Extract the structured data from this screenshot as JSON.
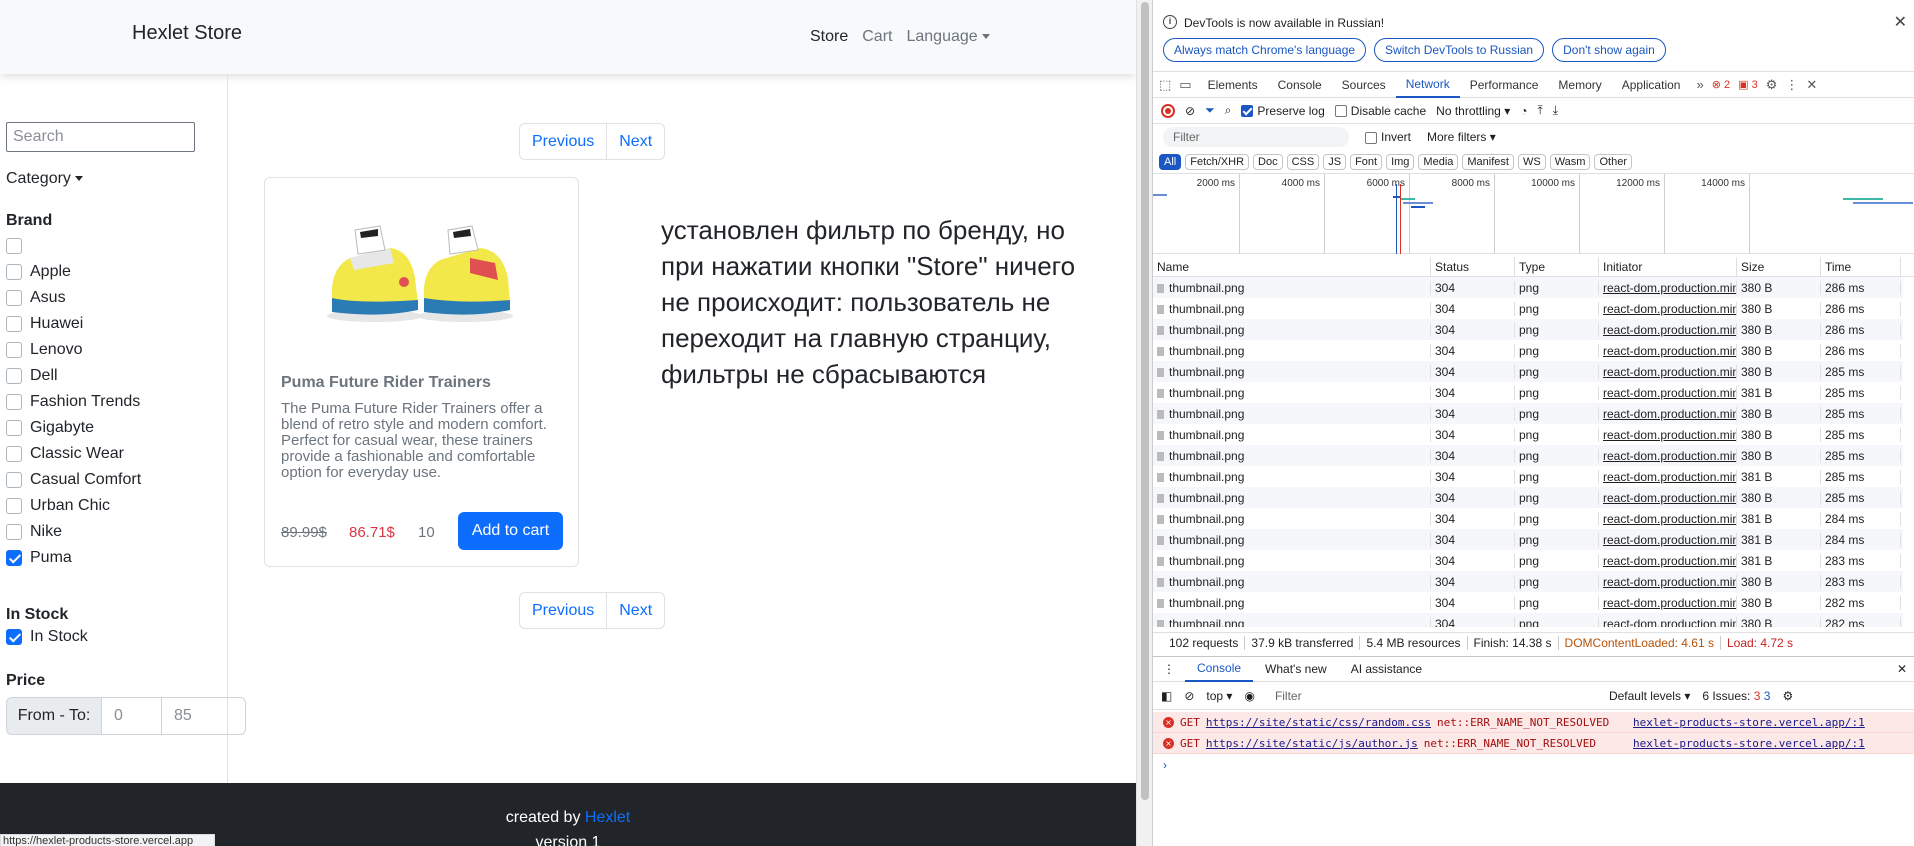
{
  "store": {
    "brand": "Hexlet Store",
    "nav": {
      "store": "Store",
      "cart": "Cart",
      "language": "Language"
    },
    "search_placeholder": "Search",
    "category": "Category",
    "brand_heading": "Brand",
    "brands": [
      {
        "label": "",
        "checked": false
      },
      {
        "label": "Apple",
        "checked": false
      },
      {
        "label": "Asus",
        "checked": false
      },
      {
        "label": "Huawei",
        "checked": false
      },
      {
        "label": "Lenovo",
        "checked": false
      },
      {
        "label": "Dell",
        "checked": false
      },
      {
        "label": "Fashion Trends",
        "checked": false
      },
      {
        "label": "Gigabyte",
        "checked": false
      },
      {
        "label": "Classic Wear",
        "checked": false
      },
      {
        "label": "Casual Comfort",
        "checked": false
      },
      {
        "label": "Urban Chic",
        "checked": false
      },
      {
        "label": "Nike",
        "checked": false
      },
      {
        "label": "Puma",
        "checked": true
      }
    ],
    "instock_heading": "In Stock",
    "instock_label": "In Stock",
    "price_heading": "Price",
    "price_label": "From - To:",
    "price_from": "0",
    "price_to": "85",
    "pager": {
      "prev": "Previous",
      "next": "Next"
    },
    "product": {
      "title": "Puma Future Rider Trainers",
      "description": "The Puma Future Rider Trainers offer a blend of retro style and modern comfort. Perfect for casual wear, these trainers provide a fashionable and comfortable option for everyday use.",
      "old_price": "89.99$",
      "new_price": "86.71$",
      "qty": "10",
      "add": "Add to cart"
    },
    "note": "установлен фильтр по бренду, но при нажатии кнопки \"Store\" ничего не происходит: пользователь не переходит на главную странциу, фильтры не сбрасываются",
    "footer": {
      "created": "created by ",
      "link": "Hexlet",
      "version": "version 1"
    },
    "status_url": "https://hexlet-products-store.vercel.app"
  },
  "devtools": {
    "info_msg": "DevTools is now available in Russian!",
    "info_buttons": [
      "Always match Chrome's language",
      "Switch DevTools to Russian",
      "Don't show again"
    ],
    "tabs": [
      "Elements",
      "Console",
      "Sources",
      "Network",
      "Performance",
      "Memory",
      "Application"
    ],
    "selected_tab": "Network",
    "error_count": "2",
    "warn_count": "3",
    "preserve_log": "Preserve log",
    "disable_cache": "Disable cache",
    "throttling": "No throttling",
    "filter_placeholder": "Filter",
    "invert": "Invert",
    "more_filters": "More filters",
    "type_filters": [
      "All",
      "Fetch/XHR",
      "Doc",
      "CSS",
      "JS",
      "Font",
      "Img",
      "Media",
      "Manifest",
      "WS",
      "Wasm",
      "Other"
    ],
    "timeline_ticks": [
      "2000 ms",
      "4000 ms",
      "6000 ms",
      "8000 ms",
      "10000 ms",
      "12000 ms",
      "14000 ms"
    ],
    "columns": [
      "Name",
      "Status",
      "Type",
      "Initiator",
      "Size",
      "Time"
    ],
    "rows": [
      {
        "name": "thumbnail.png",
        "status": "304",
        "type": "png",
        "initiator": "react-dom.production.min",
        "size": "380 B",
        "time": "286 ms"
      },
      {
        "name": "thumbnail.png",
        "status": "304",
        "type": "png",
        "initiator": "react-dom.production.min",
        "size": "380 B",
        "time": "286 ms"
      },
      {
        "name": "thumbnail.png",
        "status": "304",
        "type": "png",
        "initiator": "react-dom.production.min",
        "size": "380 B",
        "time": "286 ms"
      },
      {
        "name": "thumbnail.png",
        "status": "304",
        "type": "png",
        "initiator": "react-dom.production.min",
        "size": "380 B",
        "time": "286 ms"
      },
      {
        "name": "thumbnail.png",
        "status": "304",
        "type": "png",
        "initiator": "react-dom.production.min",
        "size": "380 B",
        "time": "285 ms"
      },
      {
        "name": "thumbnail.png",
        "status": "304",
        "type": "png",
        "initiator": "react-dom.production.min",
        "size": "381 B",
        "time": "285 ms"
      },
      {
        "name": "thumbnail.png",
        "status": "304",
        "type": "png",
        "initiator": "react-dom.production.min",
        "size": "380 B",
        "time": "285 ms"
      },
      {
        "name": "thumbnail.png",
        "status": "304",
        "type": "png",
        "initiator": "react-dom.production.min",
        "size": "380 B",
        "time": "285 ms"
      },
      {
        "name": "thumbnail.png",
        "status": "304",
        "type": "png",
        "initiator": "react-dom.production.min",
        "size": "380 B",
        "time": "285 ms"
      },
      {
        "name": "thumbnail.png",
        "status": "304",
        "type": "png",
        "initiator": "react-dom.production.min",
        "size": "381 B",
        "time": "285 ms"
      },
      {
        "name": "thumbnail.png",
        "status": "304",
        "type": "png",
        "initiator": "react-dom.production.min",
        "size": "380 B",
        "time": "285 ms"
      },
      {
        "name": "thumbnail.png",
        "status": "304",
        "type": "png",
        "initiator": "react-dom.production.min",
        "size": "381 B",
        "time": "284 ms"
      },
      {
        "name": "thumbnail.png",
        "status": "304",
        "type": "png",
        "initiator": "react-dom.production.min",
        "size": "381 B",
        "time": "284 ms"
      },
      {
        "name": "thumbnail.png",
        "status": "304",
        "type": "png",
        "initiator": "react-dom.production.min",
        "size": "381 B",
        "time": "283 ms"
      },
      {
        "name": "thumbnail.png",
        "status": "304",
        "type": "png",
        "initiator": "react-dom.production.min",
        "size": "380 B",
        "time": "283 ms"
      },
      {
        "name": "thumbnail.png",
        "status": "304",
        "type": "png",
        "initiator": "react-dom.production.min",
        "size": "380 B",
        "time": "282 ms"
      },
      {
        "name": "thumbnail.png",
        "status": "304",
        "type": "png",
        "initiator": "react-dom.production.min",
        "size": "380 B",
        "time": "282 ms"
      }
    ],
    "summary": {
      "requests": "102 requests",
      "transferred": "37.9 kB transferred",
      "resources": "5.4 MB resources",
      "finish": "Finish: 14.38 s",
      "dcl": "DOMContentLoaded: 4.61 s",
      "load": "Load: 4.72 s"
    },
    "drawer_tabs": [
      "Console",
      "What's new",
      "AI assistance"
    ],
    "console_context": "top",
    "console_filter": "Filter",
    "levels": "Default levels",
    "issues": "6 Issues:",
    "issue_err": "3",
    "issue_info": "3",
    "errors": [
      {
        "method": "GET",
        "url": "https://site/static/css/random.css",
        "msg": "net::ERR_NAME_NOT_RESOLVED",
        "source": "hexlet-products-store.vercel.app/:1"
      },
      {
        "method": "GET",
        "url": "https://site/static/js/author.js",
        "msg": "net::ERR_NAME_NOT_RESOLVED",
        "source": "hexlet-products-store.vercel.app/:1"
      }
    ]
  }
}
